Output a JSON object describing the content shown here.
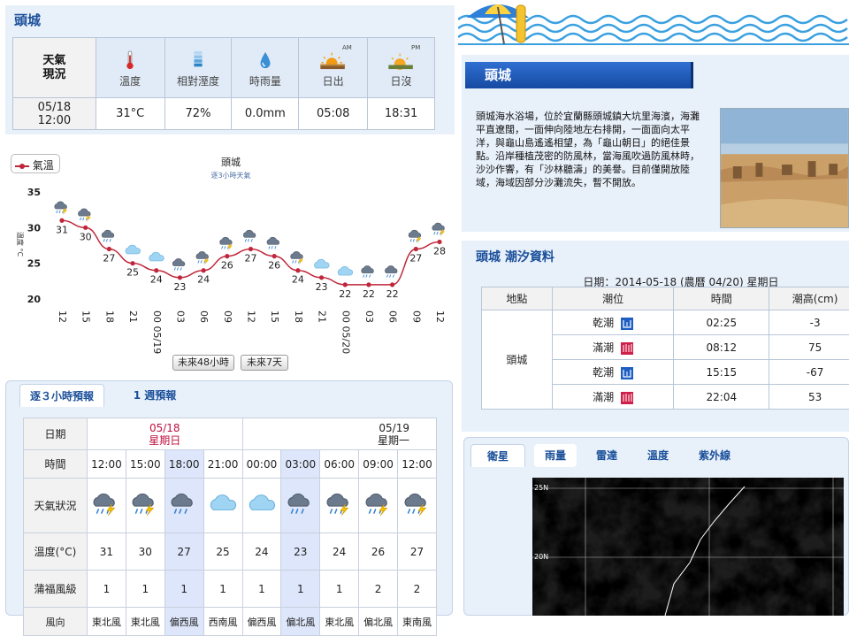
{
  "now": {
    "title": "頭城",
    "label": "天氣\n現況",
    "headers": [
      {
        "label": "溫度",
        "icon": "thermometer-icon"
      },
      {
        "label": "相對溼度",
        "icon": "humidity-bar-icon"
      },
      {
        "label": "時雨量",
        "icon": "raindrop-icon"
      },
      {
        "label": "日出",
        "icon": "sunrise-icon",
        "tag": "AM"
      },
      {
        "label": "日沒",
        "icon": "sunset-icon",
        "tag": "PM"
      }
    ],
    "date": "05/18",
    "time": "12:00",
    "values": [
      "31°C",
      "72%",
      "0.0mm",
      "05:08",
      "18:31"
    ]
  },
  "chart_data": {
    "type": "line",
    "title": "頭城",
    "subtitle": "逐3小時天氣",
    "ylabel": "溫度 °C",
    "legend": "氣溫",
    "ylim": [
      20,
      35
    ],
    "yticks": [
      20,
      25,
      30,
      35
    ],
    "x": [
      "12",
      "15",
      "18",
      "21",
      "00 05/19",
      "03",
      "06",
      "09",
      "12",
      "15",
      "18",
      "21",
      "00 05/20",
      "03",
      "06",
      "09",
      "12"
    ],
    "series": [
      {
        "name": "氣溫",
        "values": [
          31,
          30,
          27,
          25,
          24,
          23,
          24,
          26,
          27,
          26,
          24,
          23,
          22,
          22,
          22,
          27,
          28
        ]
      }
    ],
    "weather_icons": [
      "thunder",
      "thunder",
      "rain",
      "cloud",
      "cloud",
      "rain",
      "thunder",
      "thunder",
      "rain",
      "rain",
      "thunder",
      "cloud",
      "cloud",
      "rain",
      "rain",
      "thunder",
      "thunder"
    ],
    "grid": false,
    "colors": {
      "line": "#c0263a"
    }
  },
  "chart_buttons": {
    "next48": "未來48小時",
    "next7": "未來7天"
  },
  "forecast": {
    "tabs": [
      "逐３小時預報",
      "1 週預報"
    ],
    "row_labels": {
      "date": "日期",
      "time": "時間",
      "weather": "天氣狀況",
      "temp": "溫度(°C)",
      "wind": "蒲福風級",
      "dir": "風向"
    },
    "dates": [
      {
        "date": "05/18",
        "day": "星期日"
      },
      {
        "date": "05/19",
        "day": "星期一"
      }
    ],
    "times": [
      "12:00",
      "15:00",
      "18:00",
      "21:00",
      "00:00",
      "03:00",
      "06:00",
      "09:00",
      "12:00"
    ],
    "night_cols": [
      2,
      5
    ],
    "weather": [
      "thunder",
      "thunder",
      "rain",
      "cloud",
      "cloud",
      "rain",
      "thunder",
      "thunder",
      "thunder"
    ],
    "temps": [
      "31",
      "30",
      "27",
      "25",
      "24",
      "23",
      "24",
      "26",
      "27"
    ],
    "winds": [
      "1",
      "1",
      "1",
      "1",
      "1",
      "1",
      "1",
      "2",
      "2"
    ],
    "dirs": [
      "東北風",
      "東北風",
      "偏西風",
      "西南風",
      "偏西風",
      "偏北風",
      "東北風",
      "偏北風",
      "東南風"
    ]
  },
  "beach": {
    "title": "頭城",
    "description": "頭城海水浴場，位於宜蘭縣頭城鎮大坑里海濱，海灘平直遼闊，一面伸向陸地左右排開，一面面向太平洋，與龜山島遙遙相望，為「龜山朝日」的絕佳景點。沿岸種植茂密的防風林，當海風吹過防風林時，沙沙作響，有「沙林聽濤」的美譽。目前僅開放陸域，海域因部分沙灘流失，暫不開放。"
  },
  "tide": {
    "title": "頭城 潮汐資料",
    "date": "日期：2014-05-18 (農曆 04/20) 星期日",
    "headers": [
      "地點",
      "潮位",
      "時間",
      "潮高(cm)"
    ],
    "location": "頭城",
    "rows": [
      {
        "type": "乾潮",
        "kind": "low",
        "time": "02:25",
        "height": "-3"
      },
      {
        "type": "滿潮",
        "kind": "high",
        "time": "08:12",
        "height": "75"
      },
      {
        "type": "乾潮",
        "kind": "low",
        "time": "15:15",
        "height": "-67"
      },
      {
        "type": "滿潮",
        "kind": "high",
        "time": "22:04",
        "height": "53"
      }
    ]
  },
  "satellite": {
    "tabs": [
      "衛星",
      "雨量",
      "雷達",
      "溫度",
      "紫外線"
    ],
    "active": 0,
    "lat_labels": [
      "25N",
      "20N"
    ]
  }
}
